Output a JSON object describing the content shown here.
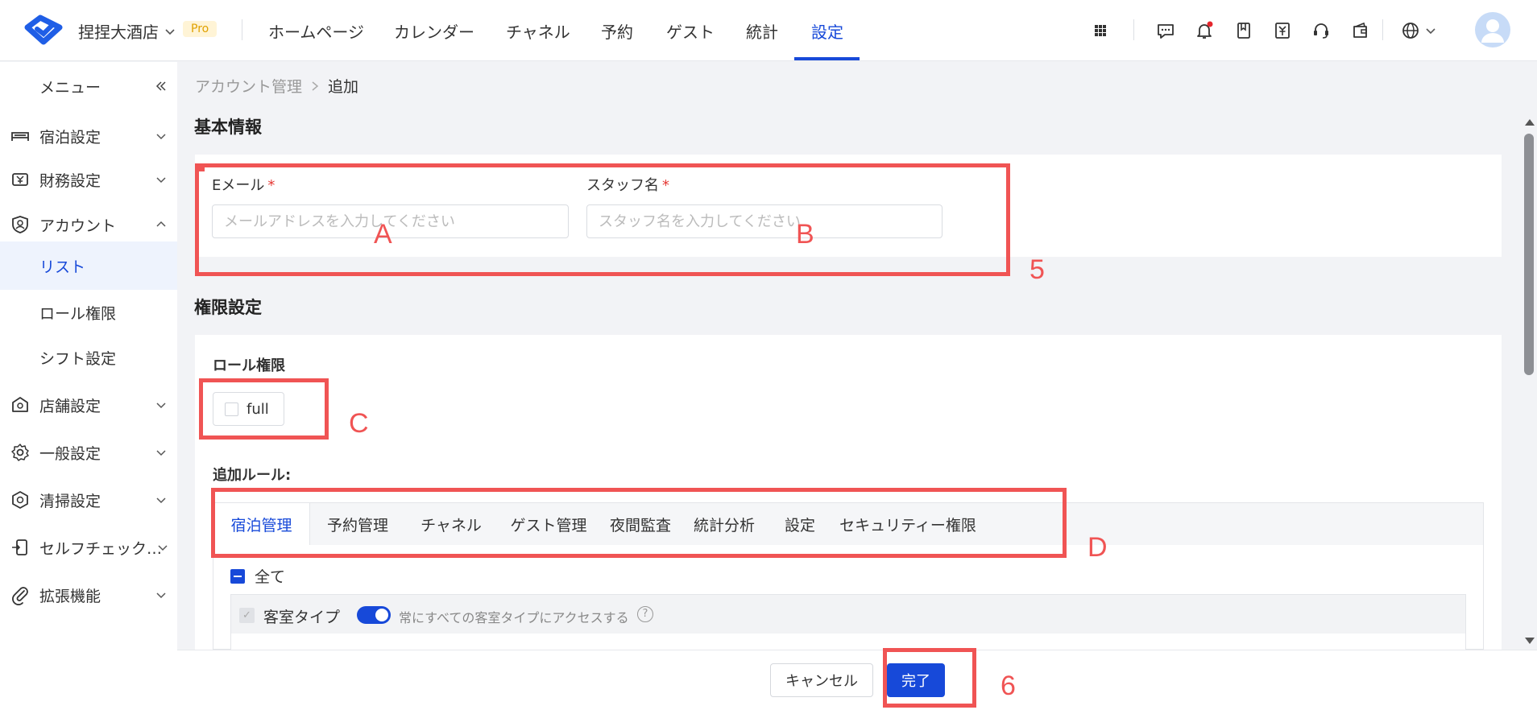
{
  "header": {
    "hotel_name": "捏捏大酒店",
    "plan_badge": "Pro",
    "nav": [
      {
        "label": "ホームページ"
      },
      {
        "label": "カレンダー"
      },
      {
        "label": "チャネル"
      },
      {
        "label": "予約"
      },
      {
        "label": "ゲスト"
      },
      {
        "label": "統計"
      },
      {
        "label": "設定",
        "active": true
      }
    ]
  },
  "sidebar": {
    "menu_label": "メニュー",
    "items": [
      {
        "label": "宿泊設定",
        "icon": "bed-icon"
      },
      {
        "label": "財務設定",
        "icon": "finance-icon"
      },
      {
        "label": "アカウント",
        "icon": "account-icon"
      },
      {
        "label": "リスト",
        "active": true
      },
      {
        "label": "ロール権限"
      },
      {
        "label": "シフト設定"
      },
      {
        "label": "店舗設定",
        "icon": "store-icon"
      },
      {
        "label": "一般設定",
        "icon": "gear-icon"
      },
      {
        "label": "清掃設定",
        "icon": "cleaning-icon"
      },
      {
        "label": "セルフチェックイン",
        "icon": "selfcheck-icon"
      },
      {
        "label": "拡張機能",
        "icon": "paperclip-icon"
      }
    ]
  },
  "breadcrumb": {
    "parent": "アカウント管理",
    "current": "追加"
  },
  "basic_info": {
    "title": "基本情報",
    "email_label": "Eメール",
    "email_placeholder": "メールアドレスを入力してください",
    "staff_label": "スタッフ名",
    "staff_placeholder": "スタッフ名を入力してください",
    "required_mark": "*"
  },
  "permissions": {
    "title": "権限設定",
    "role_label": "ロール権限",
    "role_option": "full",
    "extra_rules_label": "追加ルール:",
    "tabs": [
      "宿泊管理",
      "予約管理",
      "チャネル",
      "ゲスト管理",
      "夜間監査",
      "統計分析",
      "設定",
      "セキュリティー権限"
    ],
    "all_label": "全て",
    "room_type_label": "客室タイプ",
    "room_type_toggle_label": "常にすべての客室タイプにアクセスする",
    "help_glyph": "?"
  },
  "footer": {
    "cancel_label": "キャンセル",
    "done_label": "完了"
  },
  "annotations": [
    "A",
    "B",
    "C",
    "D",
    "5",
    "6"
  ],
  "colors": {
    "accent": "#1749d9",
    "annotation": "#f05454"
  }
}
